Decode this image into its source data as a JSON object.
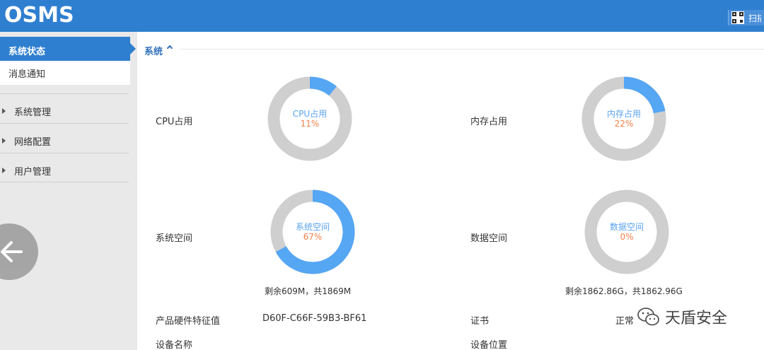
{
  "app": {
    "logo": "OSMS",
    "scan_label": "扫描"
  },
  "sidebar": {
    "active": "系统状态",
    "sub": "消息通知",
    "groups": [
      "系统管理",
      "网络配置",
      "用户管理"
    ]
  },
  "section": {
    "title": "系统"
  },
  "metrics": [
    {
      "label": "CPU占用",
      "name": "CPU占用",
      "percent": 11,
      "value_text": "11%"
    },
    {
      "label": "内存占用",
      "name": "内存占用",
      "percent": 22,
      "value_text": "22%"
    },
    {
      "label": "系统空间",
      "name": "系统空间",
      "percent": 67,
      "value_text": "67%",
      "remain": "剩余609M，共1869M"
    },
    {
      "label": "数据空间",
      "name": "数据空间",
      "percent": 0,
      "value_text": "0%",
      "remain": "剩余1862.86G，共1862.96G"
    }
  ],
  "info": {
    "hw_label": "产品硬件特征值",
    "hw_value": "D60F-C66F-59B3-BF61",
    "cert_label": "证书",
    "cert_value": "正常",
    "device_name_label": "设备名称",
    "device_location_label": "设备位置"
  },
  "watermark": "天盾安全",
  "colors": {
    "primary": "#2f7fd0",
    "gauge_fill": "#55a6f3",
    "gauge_track": "#cfcfcf",
    "value": "#f0804a"
  },
  "icons": {
    "scan": "qr-code-icon",
    "back": "arrow-left-icon",
    "collapse": "chevron-up-icon",
    "expand": "caret-right-icon"
  }
}
